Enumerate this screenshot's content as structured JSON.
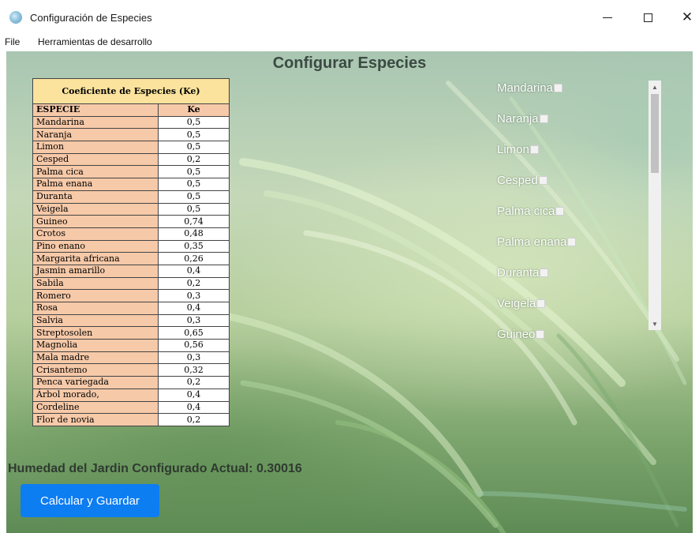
{
  "window": {
    "title": "Configuración de Especies",
    "minimize_glyph": "—",
    "maximize_glyph": "□",
    "close_glyph": "✕"
  },
  "menu": {
    "file": "File",
    "dev_tools": "Herramientas de desarrollo"
  },
  "page": {
    "heading": "Configurar Especies",
    "humidity_label": "Humedad del Jardin Configurado Actual: 0.30016",
    "calculate_button": "Calcular y Guardar"
  },
  "coefficient_table": {
    "title": "Coeficiente de Especies  (Ke)",
    "header_species": "ESPECIE",
    "header_ke": "Ke",
    "rows": [
      {
        "name": "Mandarina",
        "ke": "0,5"
      },
      {
        "name": "Naranja",
        "ke": "0,5"
      },
      {
        "name": "Limon",
        "ke": "0,5"
      },
      {
        "name": "Cesped",
        "ke": "0,2"
      },
      {
        "name": "Palma cica",
        "ke": "0,5"
      },
      {
        "name": "Palma enana",
        "ke": "0,5"
      },
      {
        "name": "Duranta",
        "ke": "0,5"
      },
      {
        "name": "Veigela",
        "ke": "0,5"
      },
      {
        "name": "Guineo",
        "ke": "0,74"
      },
      {
        "name": "Crotos",
        "ke": "0,48"
      },
      {
        "name": "Pino enano",
        "ke": "0,35"
      },
      {
        "name": "Margarita africana",
        "ke": "0,26"
      },
      {
        "name": "Jasmin amarillo",
        "ke": "0,4"
      },
      {
        "name": "Sabila",
        "ke": "0,2"
      },
      {
        "name": "Romero",
        "ke": "0,3"
      },
      {
        "name": "Rosa",
        "ke": "0,4"
      },
      {
        "name": "Salvia",
        "ke": "0,3"
      },
      {
        "name": "Streptosolen",
        "ke": "0,65"
      },
      {
        "name": "Magnolia",
        "ke": "0,56"
      },
      {
        "name": "Mala madre",
        "ke": "0,3"
      },
      {
        "name": "Crisantemo",
        "ke": "0,32"
      },
      {
        "name": "Penca variegada",
        "ke": "0,2"
      },
      {
        "name": "Árbol morado,",
        "ke": "0,4"
      },
      {
        "name": "Cordeline",
        "ke": "0,4"
      },
      {
        "name": "Flor de novia",
        "ke": "0,2"
      }
    ]
  },
  "species_checklist": [
    {
      "label": "Mandarina",
      "checked": false
    },
    {
      "label": "Naranja",
      "checked": false
    },
    {
      "label": "Limon",
      "checked": false
    },
    {
      "label": "Cesped",
      "checked": false
    },
    {
      "label": "Palma cica",
      "checked": false
    },
    {
      "label": "Palma enana",
      "checked": false
    },
    {
      "label": "Duranta",
      "checked": false
    },
    {
      "label": "Veigela",
      "checked": false
    },
    {
      "label": "Guineo",
      "checked": false
    }
  ],
  "colors": {
    "button": "#0d7df2",
    "table_header": "#fbe39d",
    "table_name_cells": "#f6c9a8"
  }
}
